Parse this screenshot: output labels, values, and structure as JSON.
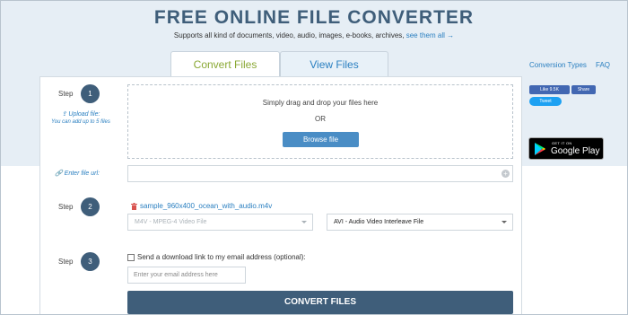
{
  "header": {
    "title": "FREE ONLINE FILE CONVERTER",
    "subtitle": "Supports all kind of documents, video, audio, images, e-books, archives,",
    "subtitle_link": "see them all →"
  },
  "tabs": [
    {
      "label": "Convert Files",
      "active": true
    },
    {
      "label": "View Files",
      "active": false
    }
  ],
  "top_links": {
    "conversion_types": "Conversion Types",
    "faq": "FAQ"
  },
  "step_word": "Step",
  "steps": [
    "1",
    "2",
    "3"
  ],
  "upload": {
    "link": "Upload file:",
    "hint": "You can add up to 5 files",
    "drop_text": "Simply drag and drop your files here",
    "or_text": "OR",
    "browse_label": "Browse file"
  },
  "url": {
    "label": "Enter file url:",
    "value": ""
  },
  "file": {
    "name": "sample_960x400_ocean_with_audio.m4v",
    "from_format": "M4V - MPEG-4 Video File",
    "to_format": "AVI - Audio Video Interleave File"
  },
  "email": {
    "checkbox_label": "Send a download link to my email address (optional):",
    "checked": false,
    "placeholder": "Enter your email address here"
  },
  "convert_label": "CONVERT FILES",
  "social": {
    "fb_like": "Like 9.5K",
    "fb_share": "Share",
    "tweet": "Tweet"
  },
  "gplay": {
    "small": "GET IT ON",
    "big": "Google Play"
  },
  "colors": {
    "primary": "#3f5e7a",
    "link": "#2a7fc0",
    "browse": "#4a8dc5",
    "active_tab": "#8aa834",
    "band": "#e6eef5"
  }
}
